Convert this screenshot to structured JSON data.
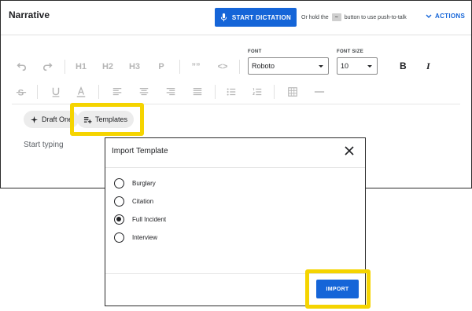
{
  "editor": {
    "title": "Narrative",
    "dictation_button": "START DICTATION",
    "hold_prefix": "Or hold the",
    "hold_key": "~",
    "hold_suffix": "button to use push-to-talk",
    "actions_label": "ACTIONS"
  },
  "toolbar": {
    "headings": [
      "H1",
      "H2",
      "H3",
      "P"
    ],
    "quote_glyph": "””",
    "code_glyph": "<>",
    "font_label": "FONT",
    "font_value": "Roboto",
    "size_label": "FONT SIZE",
    "size_value": "10",
    "bold": "B",
    "italic": "I"
  },
  "chips": {
    "draft_one": "Draft One",
    "templates": "Templates"
  },
  "body": {
    "placeholder": "Start typing"
  },
  "modal": {
    "title": "Import Template",
    "options": [
      {
        "label": "Burglary",
        "checked": false
      },
      {
        "label": "Citation",
        "checked": false
      },
      {
        "label": "Full Incident",
        "checked": true
      },
      {
        "label": "Interview",
        "checked": false
      }
    ],
    "import_button": "IMPORT"
  },
  "colors": {
    "primary": "#1565d8",
    "highlight": "#f5d400",
    "icon_muted": "#b5b5b5"
  }
}
